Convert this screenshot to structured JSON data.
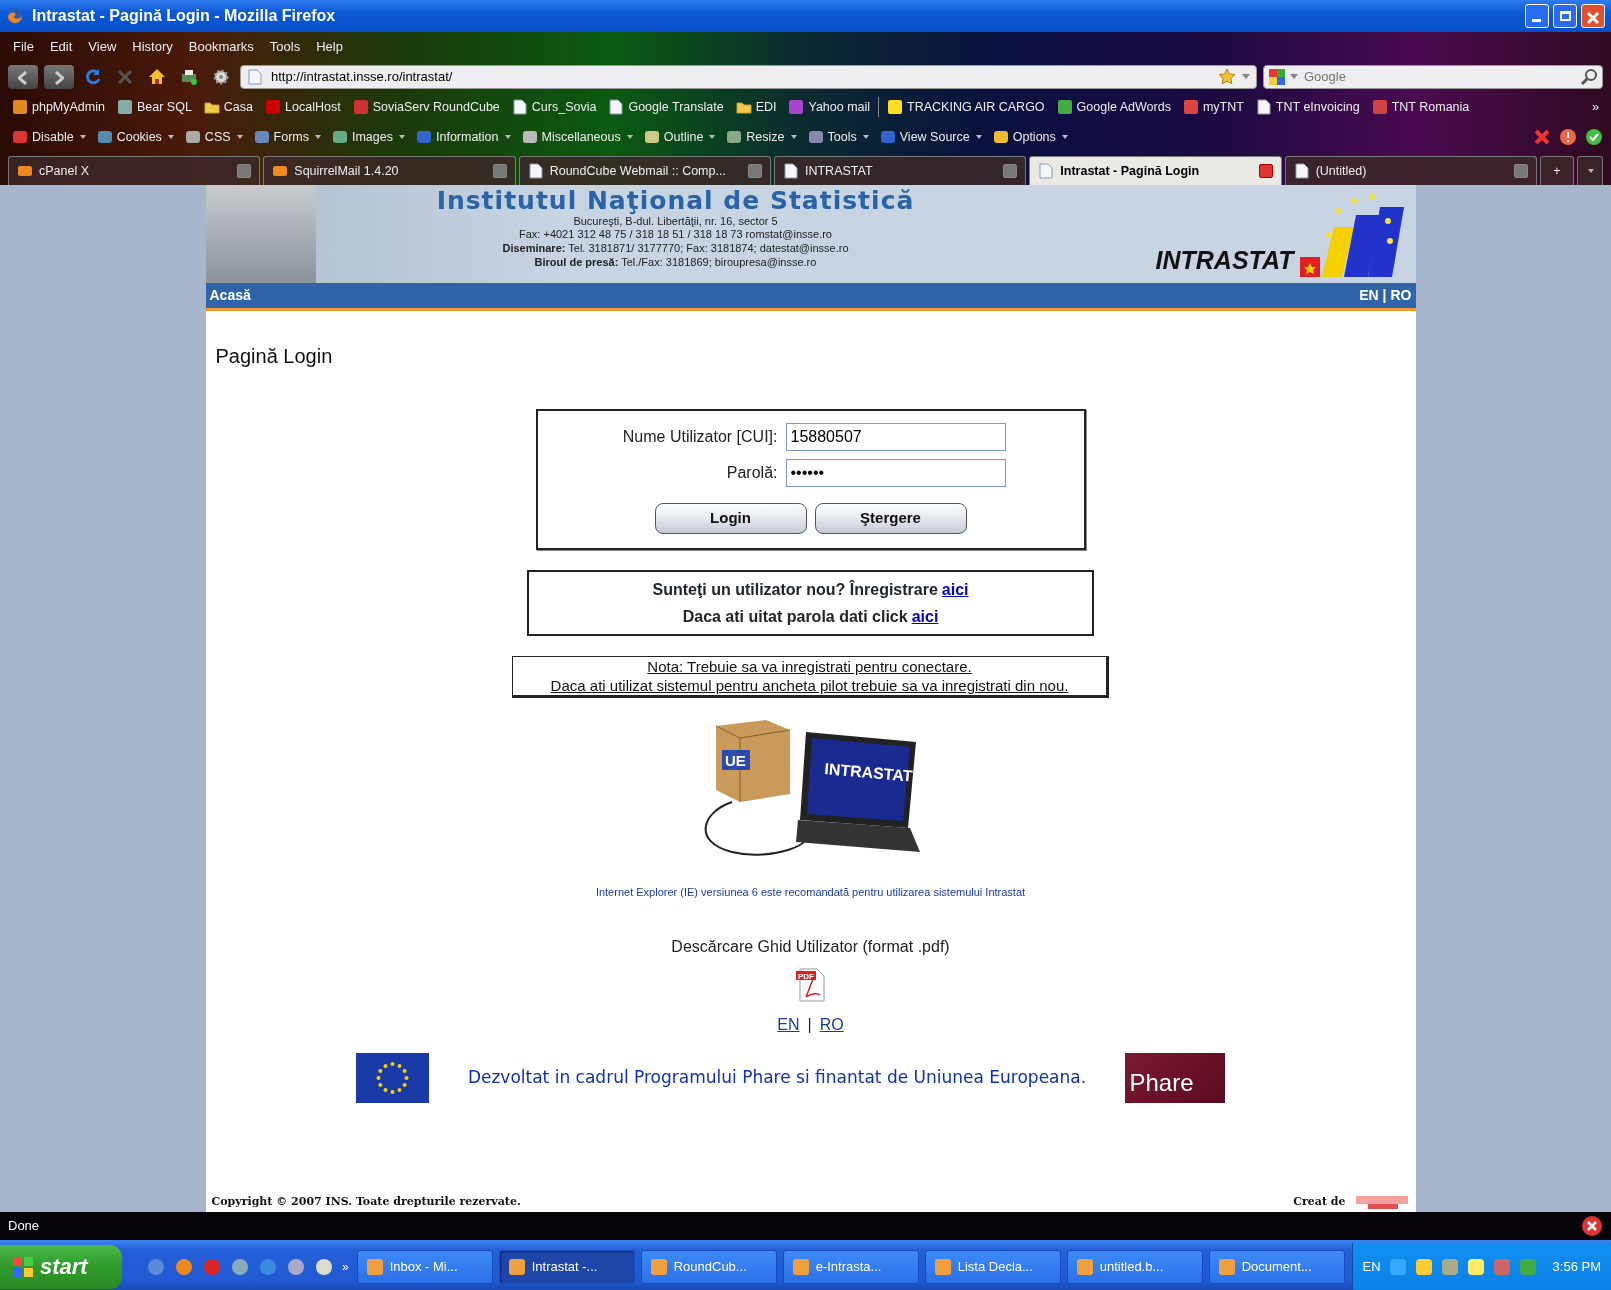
{
  "window": {
    "title": "Intrastat - Pagină Login - Mozilla Firefox"
  },
  "menu": [
    "File",
    "Edit",
    "View",
    "History",
    "Bookmarks",
    "Tools",
    "Help"
  ],
  "address_bar": {
    "url": "http://intrastat.insse.ro/intrastat/"
  },
  "search": {
    "placeholder": "Google"
  },
  "bookmarks": [
    {
      "label": "phpMyAdmin",
      "kind": "logo"
    },
    {
      "label": "Bear SQL",
      "kind": "logo"
    },
    {
      "label": "Casa",
      "kind": "folder"
    },
    {
      "label": "LocalHost",
      "kind": "logo"
    },
    {
      "label": "SoviaServ RoundCube",
      "kind": "logo"
    },
    {
      "label": "Curs_Sovia",
      "kind": "page"
    },
    {
      "label": "Google Translate",
      "kind": "page"
    },
    {
      "label": "EDI",
      "kind": "folder"
    },
    {
      "label": "Yahoo mail",
      "kind": "logo"
    },
    {
      "label": "TRACKING AIR CARGO",
      "kind": "logo"
    },
    {
      "label": "Google AdWords",
      "kind": "logo"
    },
    {
      "label": "myTNT",
      "kind": "logo"
    },
    {
      "label": "TNT eInvoicing",
      "kind": "page"
    },
    {
      "label": "TNT Romania",
      "kind": "logo"
    }
  ],
  "bookmarks_more": "»",
  "dev_toolbar": [
    "Disable",
    "Cookies",
    "CSS",
    "Forms",
    "Images",
    "Information",
    "Miscellaneous",
    "Outline",
    "Resize",
    "Tools",
    "View Source",
    "Options"
  ],
  "tabs": [
    {
      "label": "cPanel X",
      "selected": false
    },
    {
      "label": "SquirrelMail 1.4.20",
      "selected": false
    },
    {
      "label": "RoundCube Webmail :: Comp...",
      "selected": false
    },
    {
      "label": "INTRASTAT",
      "selected": false
    },
    {
      "label": "Intrastat - Pagină Login",
      "selected": true
    },
    {
      "label": "(Untitled)",
      "selected": false
    }
  ],
  "new_tab": "+",
  "page": {
    "header": {
      "institute": "Institutul Naţional de Statistică",
      "lines": [
        "Bucureşti, B-dul. Libertăţii, nr. 16, sector 5",
        "Fax: +4021 312 48 75 / 318 18 51 / 318 18 73 romstat@insse.ro",
        "**Diseminare:** Tel. 3181871/ 3177770; Fax: 3181874; datestat@insse.ro",
        "**Biroul de presă:** Tel./Fax: 3181869; biroupresa@insse.ro"
      ],
      "logo_text": "INTRASTAT"
    },
    "nav": {
      "home": "Acasă",
      "languages": [
        "EN",
        "RO"
      ],
      "separator": "|"
    },
    "heading": "Pagină Login",
    "login": {
      "fields": [
        {
          "label": "Nume Utilizator [CUI]:",
          "value": "15880507"
        },
        {
          "label": "Parolă:",
          "value": "••••••"
        }
      ],
      "buttons": [
        "Login",
        "Ştergere"
      ]
    },
    "help": [
      {
        "text": "Sunteţi un utilizator nou? Înregistrare",
        "link": "aici"
      },
      {
        "text": "Daca ati uitat parola dati click",
        "link": "aici"
      }
    ],
    "note": [
      "Nota: Trebuie sa va inregistrati pentru conectare.",
      "Daca ati utilizat sistemul pentru ancheta pilot trebuie sa va inregistrati din nou."
    ],
    "illustration": {
      "box_label": "UE",
      "screen_label": "INTRASTAT"
    },
    "recommendation": "Internet Explorer (IE) versiunea 6 este recomandată pentru utilizarea sistemului Intrastat",
    "download": "Descărcare Ghid Utilizator (format .pdf)",
    "pdf_label": "PDF",
    "languages": [
      "EN",
      "RO"
    ],
    "language_separator": "|",
    "funding": "Dezvoltat in cadrul Programului Phare si finantat de Uniunea Europeana.",
    "phare_logo": "Phare",
    "copyright": "Copyright © 2007 INS. Toate drepturile rezervate.",
    "credit": "Creat de"
  },
  "status_bar": "Done",
  "taskbar": {
    "start": "start",
    "more": "»",
    "tasks": [
      {
        "label": "Inbox - Mi...",
        "selected": false
      },
      {
        "label": "Intrastat -...",
        "selected": true
      },
      {
        "label": "RoundCub...",
        "selected": false
      },
      {
        "label": "e-Intrasta...",
        "selected": false
      },
      {
        "label": "Lista Decla...",
        "selected": false
      },
      {
        "label": "untitled.b...",
        "selected": false
      },
      {
        "label": "Document...",
        "selected": false
      }
    ],
    "language": "EN",
    "time": "3:56 PM"
  }
}
